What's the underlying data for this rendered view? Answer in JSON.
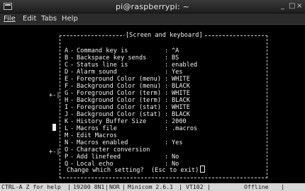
{
  "window": {
    "title": "pi@raspberrypi: ~",
    "minimize_glyph": "_",
    "maximize_glyph": "□",
    "close_glyph": "×"
  },
  "menubar": {
    "file": "File",
    "edit": "Edit",
    "tabs": "Tabs",
    "help": "Help"
  },
  "dialog": {
    "title": "[Screen and keyboard]",
    "items": [
      {
        "key": "A",
        "label": "Command key is",
        "value": "^A"
      },
      {
        "key": "B",
        "label": "Backspace key sends",
        "value": "BS"
      },
      {
        "key": "C",
        "label": "Status line is",
        "value": "enabled"
      },
      {
        "key": "D",
        "label": "Alarm sound",
        "value": "Yes"
      },
      {
        "key": "E",
        "label": "Foreground Color (menu)",
        "value": "WHITE"
      },
      {
        "key": "F",
        "label": "Background Color (menu)",
        "value": "BLACK"
      },
      {
        "key": "G",
        "label": "Foreground Color (term)",
        "value": "WHITE"
      },
      {
        "key": "H",
        "label": "Background Color (term)",
        "value": "BLACK"
      },
      {
        "key": "I",
        "label": "Foreground Color (stat)",
        "value": "WHITE"
      },
      {
        "key": "J",
        "label": "Background Color (stat)",
        "value": "BLACK"
      },
      {
        "key": "K",
        "label": "History Buffer Size",
        "value": "2000"
      },
      {
        "key": "L",
        "label": "Macros file",
        "value": ".macros"
      },
      {
        "key": "M",
        "label": "Edit Macros",
        "value": ""
      },
      {
        "key": "N",
        "label": "Macros enabled",
        "value": "Yes"
      },
      {
        "key": "O",
        "label": "Character conversion",
        "value": ""
      },
      {
        "key": "P",
        "label": "Add linefeed",
        "value": "No"
      },
      {
        "key": "Q",
        "label": "Local echo",
        "value": "No"
      }
    ],
    "prompt": "Change which setting?  (Esc to exit)"
  },
  "statusbar": {
    "help": "CTRL-A Z for help",
    "port": "19200 8N1",
    "translation": "NOR",
    "version": "Minicom 2.6.1",
    "terminal": "VT102",
    "state": "Offline"
  }
}
